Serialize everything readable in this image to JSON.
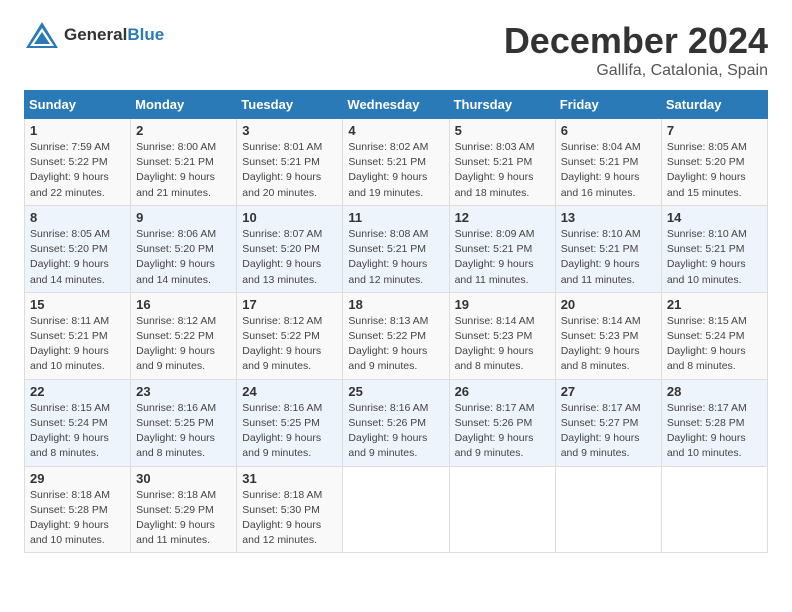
{
  "logo": {
    "text_general": "General",
    "text_blue": "Blue"
  },
  "title": "December 2024",
  "subtitle": "Gallifa, Catalonia, Spain",
  "headers": [
    "Sunday",
    "Monday",
    "Tuesday",
    "Wednesday",
    "Thursday",
    "Friday",
    "Saturday"
  ],
  "weeks": [
    [
      {
        "day": "1",
        "sunrise": "Sunrise: 7:59 AM",
        "sunset": "Sunset: 5:22 PM",
        "daylight": "Daylight: 9 hours and 22 minutes."
      },
      {
        "day": "2",
        "sunrise": "Sunrise: 8:00 AM",
        "sunset": "Sunset: 5:21 PM",
        "daylight": "Daylight: 9 hours and 21 minutes."
      },
      {
        "day": "3",
        "sunrise": "Sunrise: 8:01 AM",
        "sunset": "Sunset: 5:21 PM",
        "daylight": "Daylight: 9 hours and 20 minutes."
      },
      {
        "day": "4",
        "sunrise": "Sunrise: 8:02 AM",
        "sunset": "Sunset: 5:21 PM",
        "daylight": "Daylight: 9 hours and 19 minutes."
      },
      {
        "day": "5",
        "sunrise": "Sunrise: 8:03 AM",
        "sunset": "Sunset: 5:21 PM",
        "daylight": "Daylight: 9 hours and 18 minutes."
      },
      {
        "day": "6",
        "sunrise": "Sunrise: 8:04 AM",
        "sunset": "Sunset: 5:21 PM",
        "daylight": "Daylight: 9 hours and 16 minutes."
      },
      {
        "day": "7",
        "sunrise": "Sunrise: 8:05 AM",
        "sunset": "Sunset: 5:20 PM",
        "daylight": "Daylight: 9 hours and 15 minutes."
      }
    ],
    [
      {
        "day": "8",
        "sunrise": "Sunrise: 8:05 AM",
        "sunset": "Sunset: 5:20 PM",
        "daylight": "Daylight: 9 hours and 14 minutes."
      },
      {
        "day": "9",
        "sunrise": "Sunrise: 8:06 AM",
        "sunset": "Sunset: 5:20 PM",
        "daylight": "Daylight: 9 hours and 14 minutes."
      },
      {
        "day": "10",
        "sunrise": "Sunrise: 8:07 AM",
        "sunset": "Sunset: 5:20 PM",
        "daylight": "Daylight: 9 hours and 13 minutes."
      },
      {
        "day": "11",
        "sunrise": "Sunrise: 8:08 AM",
        "sunset": "Sunset: 5:21 PM",
        "daylight": "Daylight: 9 hours and 12 minutes."
      },
      {
        "day": "12",
        "sunrise": "Sunrise: 8:09 AM",
        "sunset": "Sunset: 5:21 PM",
        "daylight": "Daylight: 9 hours and 11 minutes."
      },
      {
        "day": "13",
        "sunrise": "Sunrise: 8:10 AM",
        "sunset": "Sunset: 5:21 PM",
        "daylight": "Daylight: 9 hours and 11 minutes."
      },
      {
        "day": "14",
        "sunrise": "Sunrise: 8:10 AM",
        "sunset": "Sunset: 5:21 PM",
        "daylight": "Daylight: 9 hours and 10 minutes."
      }
    ],
    [
      {
        "day": "15",
        "sunrise": "Sunrise: 8:11 AM",
        "sunset": "Sunset: 5:21 PM",
        "daylight": "Daylight: 9 hours and 10 minutes."
      },
      {
        "day": "16",
        "sunrise": "Sunrise: 8:12 AM",
        "sunset": "Sunset: 5:22 PM",
        "daylight": "Daylight: 9 hours and 9 minutes."
      },
      {
        "day": "17",
        "sunrise": "Sunrise: 8:12 AM",
        "sunset": "Sunset: 5:22 PM",
        "daylight": "Daylight: 9 hours and 9 minutes."
      },
      {
        "day": "18",
        "sunrise": "Sunrise: 8:13 AM",
        "sunset": "Sunset: 5:22 PM",
        "daylight": "Daylight: 9 hours and 9 minutes."
      },
      {
        "day": "19",
        "sunrise": "Sunrise: 8:14 AM",
        "sunset": "Sunset: 5:23 PM",
        "daylight": "Daylight: 9 hours and 8 minutes."
      },
      {
        "day": "20",
        "sunrise": "Sunrise: 8:14 AM",
        "sunset": "Sunset: 5:23 PM",
        "daylight": "Daylight: 9 hours and 8 minutes."
      },
      {
        "day": "21",
        "sunrise": "Sunrise: 8:15 AM",
        "sunset": "Sunset: 5:24 PM",
        "daylight": "Daylight: 9 hours and 8 minutes."
      }
    ],
    [
      {
        "day": "22",
        "sunrise": "Sunrise: 8:15 AM",
        "sunset": "Sunset: 5:24 PM",
        "daylight": "Daylight: 9 hours and 8 minutes."
      },
      {
        "day": "23",
        "sunrise": "Sunrise: 8:16 AM",
        "sunset": "Sunset: 5:25 PM",
        "daylight": "Daylight: 9 hours and 8 minutes."
      },
      {
        "day": "24",
        "sunrise": "Sunrise: 8:16 AM",
        "sunset": "Sunset: 5:25 PM",
        "daylight": "Daylight: 9 hours and 9 minutes."
      },
      {
        "day": "25",
        "sunrise": "Sunrise: 8:16 AM",
        "sunset": "Sunset: 5:26 PM",
        "daylight": "Daylight: 9 hours and 9 minutes."
      },
      {
        "day": "26",
        "sunrise": "Sunrise: 8:17 AM",
        "sunset": "Sunset: 5:26 PM",
        "daylight": "Daylight: 9 hours and 9 minutes."
      },
      {
        "day": "27",
        "sunrise": "Sunrise: 8:17 AM",
        "sunset": "Sunset: 5:27 PM",
        "daylight": "Daylight: 9 hours and 9 minutes."
      },
      {
        "day": "28",
        "sunrise": "Sunrise: 8:17 AM",
        "sunset": "Sunset: 5:28 PM",
        "daylight": "Daylight: 9 hours and 10 minutes."
      }
    ],
    [
      {
        "day": "29",
        "sunrise": "Sunrise: 8:18 AM",
        "sunset": "Sunset: 5:28 PM",
        "daylight": "Daylight: 9 hours and 10 minutes."
      },
      {
        "day": "30",
        "sunrise": "Sunrise: 8:18 AM",
        "sunset": "Sunset: 5:29 PM",
        "daylight": "Daylight: 9 hours and 11 minutes."
      },
      {
        "day": "31",
        "sunrise": "Sunrise: 8:18 AM",
        "sunset": "Sunset: 5:30 PM",
        "daylight": "Daylight: 9 hours and 12 minutes."
      },
      null,
      null,
      null,
      null
    ]
  ]
}
